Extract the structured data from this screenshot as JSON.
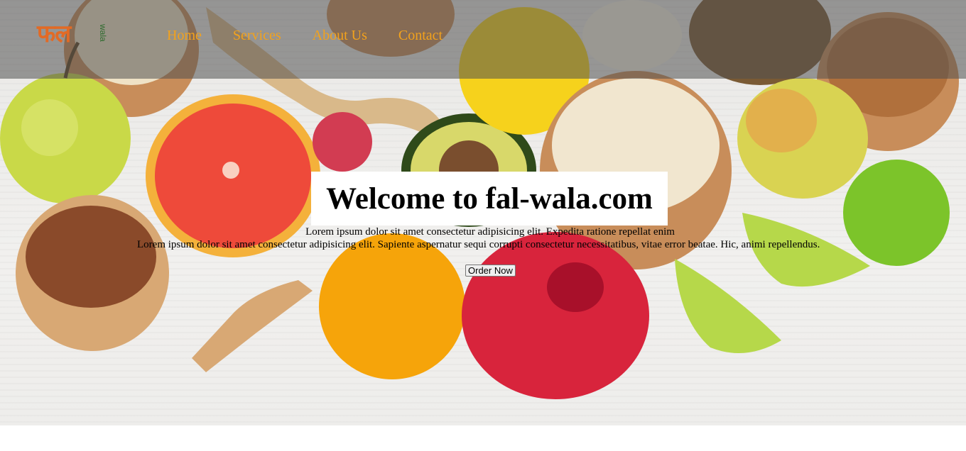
{
  "brand": {
    "logo_text": "फल",
    "logo_subtext": "wala"
  },
  "nav": {
    "items": [
      {
        "label": "Home"
      },
      {
        "label": "Services"
      },
      {
        "label": "About Us"
      },
      {
        "label": "Contact"
      }
    ]
  },
  "hero": {
    "title": "Welcome to fal-wala.com",
    "tagline": "Lorem ipsum dolor sit amet consectetur adipisicing elit. Expedita ratione repellat enim",
    "description": "Lorem ipsum dolor sit amet consectetur adipisicing elit. Sapiente aspernatur sequi corrupti consectetur necessitatibus, vitae error beatae. Hic, animi repellendus.",
    "cta_label": "Order Now"
  },
  "colors": {
    "nav_link": "#f3a21c",
    "logo": "#e26a25",
    "logo_sub": "#2e6b2e",
    "navbar_overlay": "rgba(80,80,80,0.55)"
  }
}
